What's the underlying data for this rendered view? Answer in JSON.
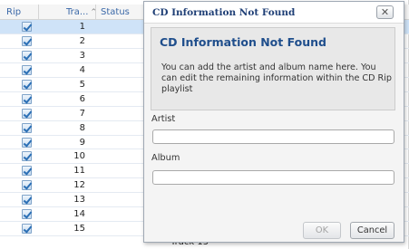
{
  "list": {
    "headers": {
      "rip": "Rip",
      "track": "Tra...",
      "status": "Status"
    },
    "sort_arrow": "^",
    "rows": [
      {
        "number": "1",
        "checked": true
      },
      {
        "number": "2",
        "checked": true
      },
      {
        "number": "3",
        "checked": true
      },
      {
        "number": "4",
        "checked": true
      },
      {
        "number": "5",
        "checked": true
      },
      {
        "number": "6",
        "checked": true
      },
      {
        "number": "7",
        "checked": true
      },
      {
        "number": "8",
        "checked": true
      },
      {
        "number": "9",
        "checked": true
      },
      {
        "number": "10",
        "checked": true
      },
      {
        "number": "11",
        "checked": true
      },
      {
        "number": "12",
        "checked": true
      },
      {
        "number": "13",
        "checked": true
      },
      {
        "number": "14",
        "checked": true
      },
      {
        "number": "15",
        "checked": true
      }
    ],
    "partial_track_title": "Track 15"
  },
  "dialog": {
    "title": "CD Information Not Found",
    "close_glyph": "✕",
    "heading": "CD Information Not Found",
    "message": "You can add the artist and album name here. You can edit the remaining information within the CD Rip playlist",
    "artist_label": "Artist",
    "artist_value": "",
    "album_label": "Album",
    "album_value": "",
    "ok_label": "OK",
    "cancel_label": "Cancel"
  }
}
